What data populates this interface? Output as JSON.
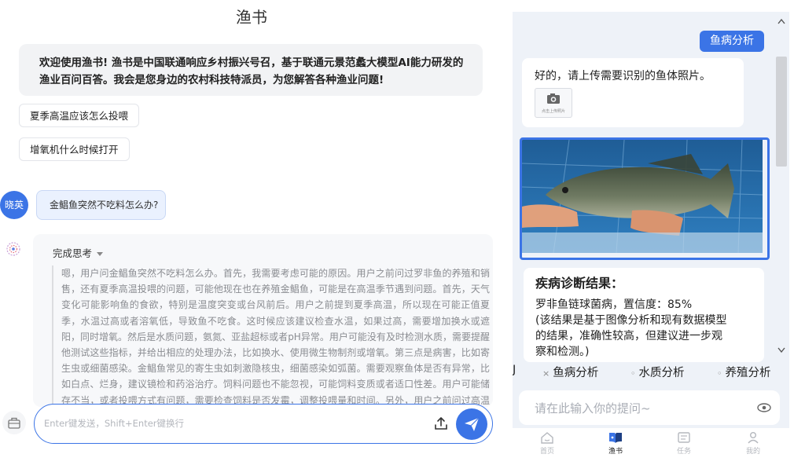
{
  "left": {
    "app_title": "渔书",
    "welcome_text": "欢迎使用渔书! 渔书是中国联通响应乡村振兴号召，基于联通元景范蠡大模型AI能力研发的渔业百问百答。我会是您身边的农村科技特派员，为您解答各种渔业问题!",
    "suggestions": [
      "夏季高温应该怎么投喂",
      "增氧机什么时候打开"
    ],
    "user_avatar_label": "晓英",
    "user_question": "金鲳鱼突然不吃料怎么办?",
    "thinking_header": "完成思考",
    "thinking_text": "嗯，用户问金鲳鱼突然不吃料怎么办。首先，我需要考虑可能的原因。用户之前问过罗非鱼的养殖和销售，还有夏季高温投喂的问题，可能他现在也在养殖金鲳鱼，可能是在高温季节遇到问题。首先，天气变化可能影响鱼的食欲，特别是温度突变或台风前后。用户之前提到夏季高温，所以现在可能正值夏季，水温过高或者溶氧低，导致鱼不吃食。这时候应该建议检查水温，如果过高，需要增加换水或遮阳，同时增氧。然后是水质问题，氨氮、亚盐超标或者pH异常。用户可能没有及时检测水质，需要提醒他测试这些指标，并给出相应的处理办法，比如换水、使用微生物制剂或增氧。第三点是病害，比如寄生虫或细菌感染。金鲳鱼常见的寄生虫如刺激隐核虫，细菌感染如弧菌。需要观察鱼体是否有异常，比如白点、烂身，建议镜检和药浴治疗。饲料问题也不能忽视，可能饲料变质或者适口性差。用户可能储存不当，或者投喂方式有问题，需要检查饲料是否发霉，调整投喂量和时间。另外，用户之前问过高温投喂，可能现在投喂量过大，导致消化不良，建议减少投喂，添加助消化物质，比如乳酸菌。最后，应激反应，比",
    "composer_placeholder": "Enter键发送，Shift+Enter键换行"
  },
  "right": {
    "top_tag": "鱼病分析",
    "prompt_text": "好的，请上传需要识别的鱼体照片。",
    "camera_caption": "点击上传照片",
    "diagnosis_title": "疾病诊断结果：",
    "diagnosis_lines": [
      "罗非鱼链球菌病，置信度：85%",
      "(该结果是基于图像分析和现有数据模型",
      "的结果，准确性较高，但建议进一步观",
      "察和检测。)"
    ],
    "chip_partial": "J",
    "chips": [
      "鱼病分析",
      "水质分析",
      "养殖分析"
    ],
    "input_placeholder": "请在此输入你的提问~",
    "tabs": [
      "首页",
      "渔书",
      "任务",
      "我的"
    ],
    "active_tab": "渔书"
  },
  "colors": {
    "accent": "#3b74e6",
    "welcome_bg": "#f2f3f5",
    "phone_bg": "#eef2f8",
    "thinking_text": "#8a8c91"
  }
}
